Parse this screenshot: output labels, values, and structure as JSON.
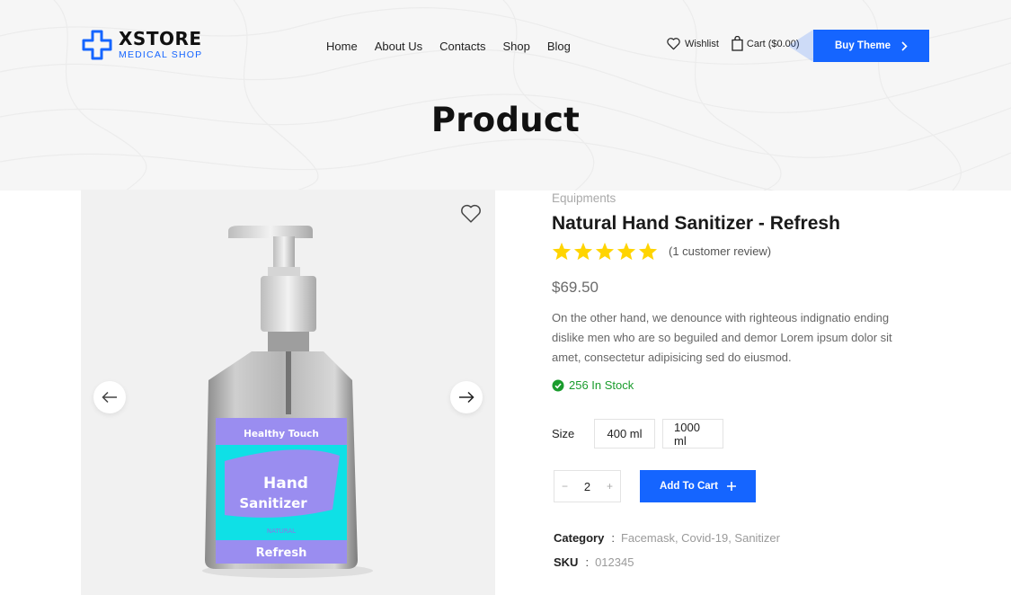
{
  "brand": {
    "name": "XSTORE",
    "tagline": "MEDICAL SHOP",
    "accent_color": "#1565ff"
  },
  "nav": {
    "items": [
      {
        "label": "Home"
      },
      {
        "label": "About Us"
      },
      {
        "label": "Contacts"
      },
      {
        "label": "Shop"
      },
      {
        "label": "Blog"
      }
    ]
  },
  "header": {
    "wishlist_label": "Wishlist",
    "cart_label": "Cart ($0.00)",
    "buy_button": "Buy Theme"
  },
  "page": {
    "title": "Product"
  },
  "product": {
    "category": "Equipments",
    "name": "Natural Hand Sanitizer - Refresh",
    "rating": 5,
    "rating_max": 5,
    "review_text": "(1 customer review)",
    "price": "$69.50",
    "description": "On the other hand, we denounce with righteous indignatio ending dislike men who are so beguiled and demor Lorem ipsum dolor sit amet, consectetur adipisicing sed do eiusmod.",
    "stock_text": "256 In Stock",
    "size_label": "Size",
    "sizes": [
      "400 ml",
      "1000 ml"
    ],
    "quantity": "2",
    "add_to_cart": "Add To Cart",
    "meta": {
      "category_key": "Category",
      "category_value": "Facemask, Covid-19, Sanitizer",
      "sku_key": "SKU",
      "sku_value": "012345",
      "separator": ":"
    },
    "label_art": {
      "brand": "Healthy Touch",
      "line1": "Hand",
      "line2": "Sanitizer",
      "tag": "NATURAL",
      "variant": "Refresh"
    }
  },
  "colors": {
    "star": "#ffd400",
    "stock": "#1a9c2d",
    "label_cyan": "#0fe0e6",
    "label_purple": "#9a8df0"
  }
}
